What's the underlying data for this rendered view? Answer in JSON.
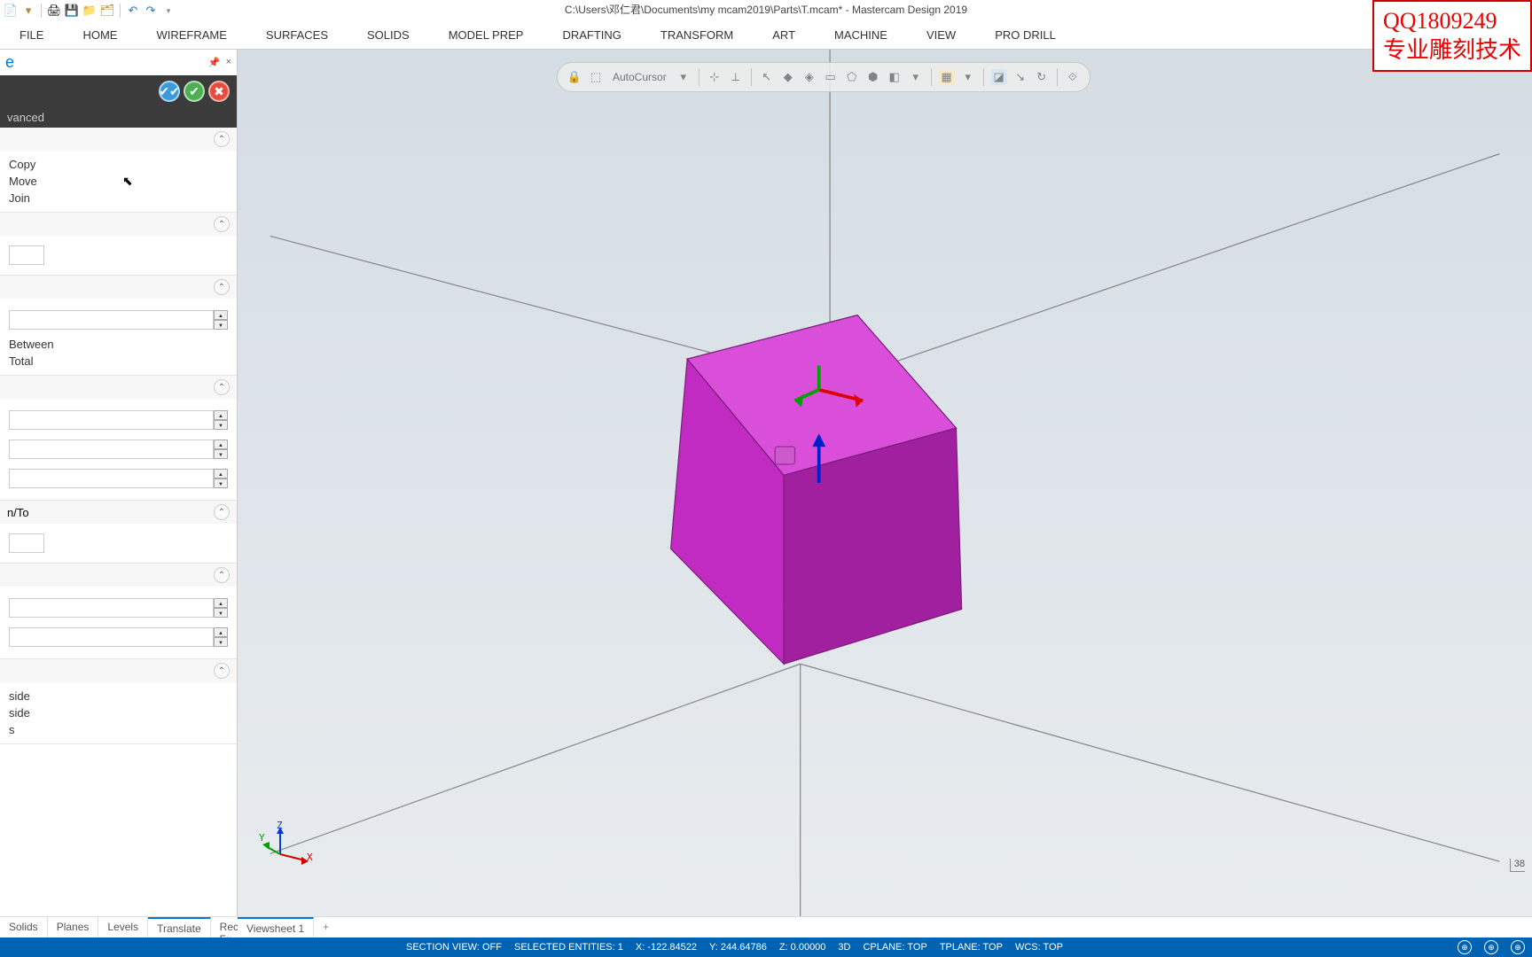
{
  "title": "C:\\Users\\邓仁君\\Documents\\my mcam2019\\Parts\\T.mcam* - Mastercam Design 2019",
  "ribbon": [
    "FILE",
    "HOME",
    "WIREFRAME",
    "SURFACES",
    "SOLIDS",
    "MODEL PREP",
    "DRAFTING",
    "TRANSFORM",
    "ART",
    "MACHINE",
    "VIEW",
    "PRO DRILL"
  ],
  "panel": {
    "title": "e",
    "pin": "📌",
    "close": "×",
    "tab": "vanced",
    "method": {
      "copy": "Copy",
      "move": "Move",
      "join": "Join"
    },
    "dist": {
      "between": "Between",
      "total": "Total"
    },
    "fromto": "n/To",
    "dir": {
      "side": "side",
      "side2": "side",
      "s": "s"
    }
  },
  "float_toolbar": {
    "autocursor": "AutoCursor"
  },
  "bottom_tabs_left": [
    "Solids",
    "Planes",
    "Levels",
    "Translate",
    "Recent Fu..."
  ],
  "bottom_tabs_right": {
    "sheet": "Viewsheet 1",
    "add": "+"
  },
  "status": {
    "section": "SECTION VIEW: OFF",
    "selected": "SELECTED ENTITIES: 1",
    "x": "X:   -122.84522",
    "y": "Y:   244.64786",
    "z": "Z:   0.00000",
    "mode": "3D",
    "cplane": "CPLANE: TOP",
    "tplane": "TPLANE: TOP",
    "wcs": "WCS: TOP"
  },
  "gnomon": {
    "x": "X",
    "y": "Y",
    "z": "Z"
  },
  "scale": "38",
  "watermark": {
    "l1": "QQ1809249",
    "l2": "专业雕刻技术"
  }
}
